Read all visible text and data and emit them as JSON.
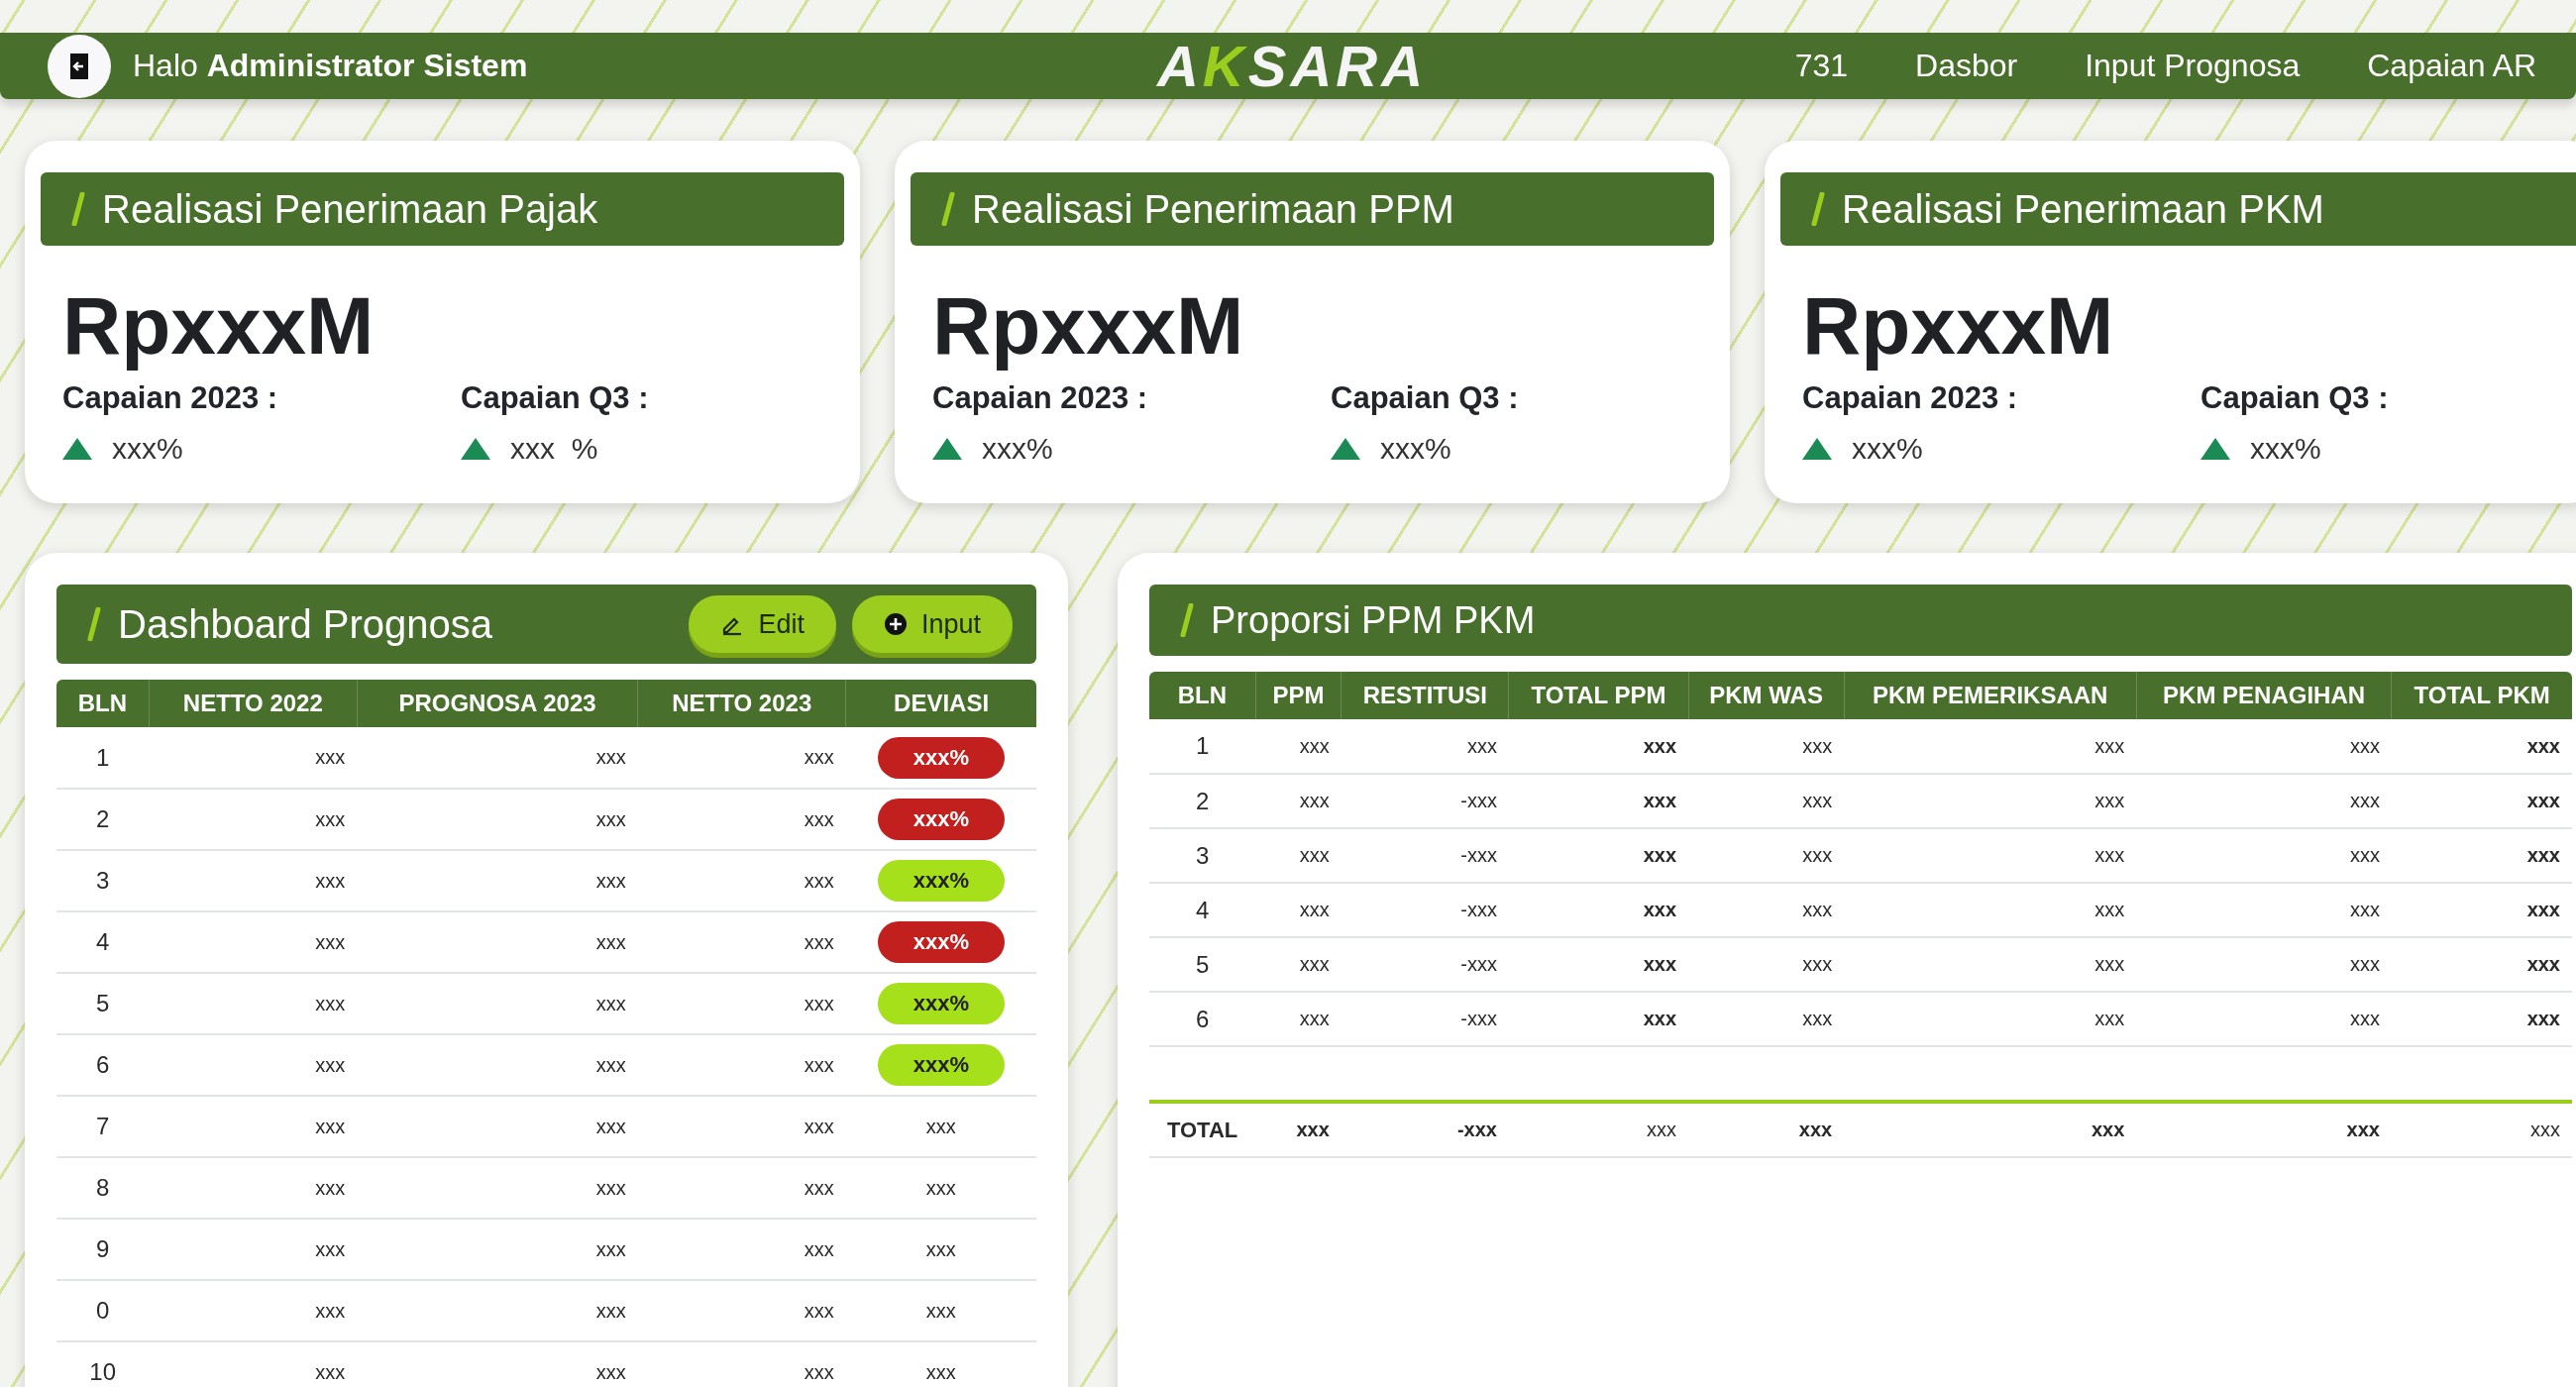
{
  "header": {
    "greeting": "Halo **Administrator Sistem**",
    "logo": [
      {
        "text": "A",
        "accent": false
      },
      {
        "text": "K",
        "accent": true
      },
      {
        "text": "SARA",
        "accent": false
      }
    ],
    "nav": [
      "731",
      "Dasbor",
      "Input Prognosa",
      "Capaian AR"
    ]
  },
  "cards": [
    {
      "title": "Realisasi Penerimaan Pajak",
      "amount": "RpxxxM",
      "stats": [
        {
          "label": "Capaian 2023 :",
          "value": "xxx%"
        },
        {
          "label": "Capaian Q3 :",
          "value": "xxx  %"
        }
      ]
    },
    {
      "title": "Realisasi Penerimaan PPM",
      "amount": "RpxxxM",
      "stats": [
        {
          "label": "Capaian 2023 :",
          "value": "xxx%"
        },
        {
          "label": "Capaian Q3 :",
          "value": "xxx%"
        }
      ]
    },
    {
      "title": "Realisasi Penerimaan PKM",
      "amount": "RpxxxM",
      "stats": [
        {
          "label": "Capaian 2023 :",
          "value": "xxx%"
        },
        {
          "label": "Capaian Q3 :",
          "value": "xxx%"
        }
      ]
    }
  ],
  "prognosa": {
    "title": "Dashboard Prognosa",
    "buttons": [
      {
        "kind": "edit",
        "label": "Edit"
      },
      {
        "kind": "input",
        "label": "Input"
      }
    ],
    "columns": [
      "BLN",
      "NETTO 2022",
      "PROGNOSA 2023",
      "NETTO 2023",
      "DEVIASI"
    ],
    "rows": [
      {
        "bln": "1",
        "netto_2022": "xxx",
        "prognosa_2023": "xxx",
        "netto_2023": "xxx",
        "deviasi": {
          "kind": "badge",
          "color": "#c21f1f",
          "text": "xxx%"
        }
      },
      {
        "bln": "2",
        "netto_2022": "xxx",
        "prognosa_2023": "xxx",
        "netto_2023": "xxx",
        "deviasi": {
          "kind": "badge",
          "color": "#c21f1f",
          "text": "xxx%"
        }
      },
      {
        "bln": "3",
        "netto_2022": "xxx",
        "prognosa_2023": "xxx",
        "netto_2023": "xxx",
        "deviasi": {
          "kind": "badge",
          "color": "#a6e01a",
          "text": "xxx%"
        }
      },
      {
        "bln": "4",
        "netto_2022": "xxx",
        "prognosa_2023": "xxx",
        "netto_2023": "xxx",
        "deviasi": {
          "kind": "badge",
          "color": "#c21f1f",
          "text": "xxx%"
        }
      },
      {
        "bln": "5",
        "netto_2022": "xxx",
        "prognosa_2023": "xxx",
        "netto_2023": "xxx",
        "deviasi": {
          "kind": "badge",
          "color": "#a6e01a",
          "text": "xxx%"
        }
      },
      {
        "bln": "6",
        "netto_2022": "xxx",
        "prognosa_2023": "xxx",
        "netto_2023": "xxx",
        "deviasi": {
          "kind": "badge",
          "color": "#a6e01a",
          "text": "xxx%"
        }
      },
      {
        "bln": "7",
        "netto_2022": "xxx",
        "prognosa_2023": "xxx",
        "netto_2023": "xxx",
        "deviasi": {
          "kind": "plain",
          "text": "xxx"
        }
      },
      {
        "bln": "8",
        "netto_2022": "xxx",
        "prognosa_2023": "xxx",
        "netto_2023": "xxx",
        "deviasi": {
          "kind": "plain",
          "text": "xxx"
        }
      },
      {
        "bln": "9",
        "netto_2022": "xxx",
        "prognosa_2023": "xxx",
        "netto_2023": "xxx",
        "deviasi": {
          "kind": "plain",
          "text": "xxx"
        }
      },
      {
        "bln": "0",
        "netto_2022": "xxx",
        "prognosa_2023": "xxx",
        "netto_2023": "xxx",
        "deviasi": {
          "kind": "plain",
          "text": "xxx"
        }
      },
      {
        "bln": "10",
        "netto_2022": "xxx",
        "prognosa_2023": "xxx",
        "netto_2023": "xxx",
        "deviasi": {
          "kind": "plain",
          "text": "xxx"
        }
      }
    ]
  },
  "proporsi": {
    "title": "Proporsi PPM PKM",
    "columns": [
      "BLN",
      "PPM",
      "RESTITUSI",
      "TOTAL PPM",
      "PKM WAS",
      "PKM PEMERIKSAAN",
      "PKM PENAGIHAN",
      "TOTAL PKM"
    ],
    "rows": [
      [
        "1",
        "xxx",
        "xxx",
        "xxx",
        "xxx",
        "xxx",
        "xxx",
        "xxx"
      ],
      [
        "2",
        "xxx",
        "-xxx",
        "xxx",
        "xxx",
        "xxx",
        "xxx",
        "xxx"
      ],
      [
        "3",
        "xxx",
        "-xxx",
        "xxx",
        "xxx",
        "xxx",
        "xxx",
        "xxx"
      ],
      [
        "4",
        "xxx",
        "-xxx",
        "xxx",
        "xxx",
        "xxx",
        "xxx",
        "xxx"
      ],
      [
        "5",
        "xxx",
        "-xxx",
        "xxx",
        "xxx",
        "xxx",
        "xxx",
        "xxx"
      ],
      [
        "6",
        "xxx",
        "-xxx",
        "xxx",
        "xxx",
        "xxx",
        "xxx",
        "xxx"
      ]
    ],
    "total": [
      {
        "text": "TOTAL",
        "bold": true
      },
      {
        "text": "xxx",
        "bold": true
      },
      {
        "text": "-xxx",
        "bold": true
      },
      {
        "text": "xxx",
        "bold": false
      },
      {
        "text": "xxx",
        "bold": true
      },
      {
        "text": "xxx",
        "bold": true
      },
      {
        "text": "xxx",
        "bold": true
      },
      {
        "text": "xxx",
        "bold": false
      }
    ]
  }
}
